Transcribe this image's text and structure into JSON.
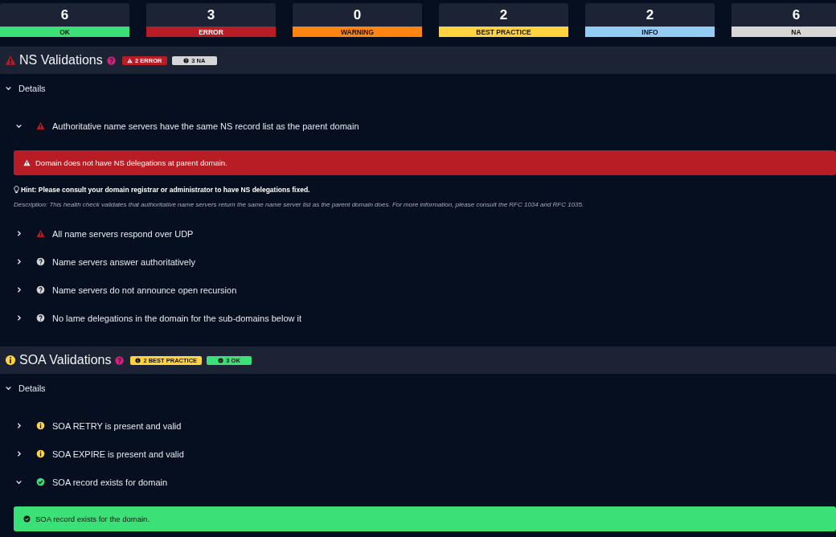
{
  "summary": [
    {
      "count": "6",
      "label": "OK",
      "kind": "ok"
    },
    {
      "count": "3",
      "label": "ERROR",
      "kind": "error"
    },
    {
      "count": "0",
      "label": "WARNING",
      "kind": "warning"
    },
    {
      "count": "2",
      "label": "BEST PRACTICE",
      "kind": "best_practice"
    },
    {
      "count": "2",
      "label": "INFO",
      "kind": "info"
    },
    {
      "count": "6",
      "label": "NA",
      "kind": "na"
    }
  ],
  "sections": [
    {
      "title": "NS Validations",
      "kind": "error",
      "badges": [
        {
          "kind": "error",
          "text": "2 ERROR"
        },
        {
          "kind": "na",
          "text": "3 NA"
        }
      ],
      "details": {
        "label": "Details",
        "expanded": true
      },
      "checks": [
        {
          "kind": "error",
          "title": "Authoritative name servers have the same NS record list as the parent domain",
          "expanded": true,
          "message": "Domain does not have NS delegations at parent domain.",
          "hint": "Hint: Please consult your domain registrar or administrator to have NS delegations fixed.",
          "description": "Description: This health check validates that authoritative name servers return the same name server list as the parent domain does. For more information, please consult the RFC 1034 and RFC 1035."
        },
        {
          "kind": "error",
          "title": "All name servers respond over UDP",
          "expanded": false
        },
        {
          "kind": "na",
          "title": "Name servers answer authoritatively",
          "expanded": false
        },
        {
          "kind": "na",
          "title": "Name servers do not announce open recursion",
          "expanded": false
        },
        {
          "kind": "na",
          "title": "No lame delegations in the domain for the sub-domains below it",
          "expanded": false
        }
      ]
    },
    {
      "title": "SOA Validations",
      "kind": "best_practice",
      "badges": [
        {
          "kind": "best_practice",
          "text": "2 BEST PRACTICE"
        },
        {
          "kind": "ok",
          "text": "3 OK"
        }
      ],
      "details": {
        "label": "Details",
        "expanded": true
      },
      "checks": [
        {
          "kind": "best_practice",
          "title": "SOA RETRY is present and valid",
          "expanded": false
        },
        {
          "kind": "best_practice",
          "title": "SOA EXPIRE is present and valid",
          "expanded": false
        },
        {
          "kind": "ok",
          "title": "SOA record exists for domain",
          "expanded": true,
          "message": "SOA record exists for the domain."
        }
      ]
    }
  ]
}
